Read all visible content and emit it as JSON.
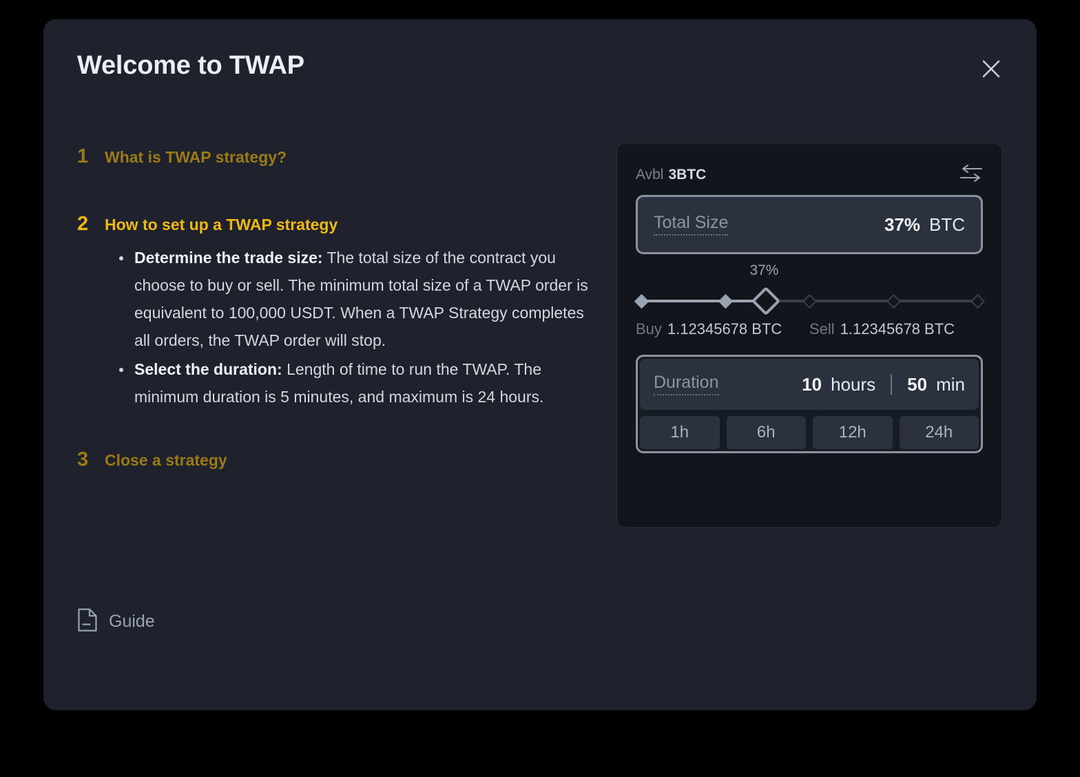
{
  "dialog": {
    "title": "Welcome to TWAP",
    "close_icon": "close-icon"
  },
  "steps": [
    {
      "number": "1",
      "title": "What is TWAP strategy?",
      "state": "inactive"
    },
    {
      "number": "2",
      "title": "How to set up a TWAP strategy",
      "state": "active"
    },
    {
      "number": "3",
      "title": "Close a strategy",
      "state": "inactive"
    }
  ],
  "bullets": [
    {
      "lead": "Determine the trade size:",
      "body": " The total size of the contract you choose to buy or sell. The minimum total size of a TWAP order is equivalent to 100,000 USDT. When a TWAP Strategy completes all orders, the TWAP order will stop."
    },
    {
      "lead": "Select the duration:",
      "body": " Length of time to run the TWAP. The minimum duration is 5 minutes, and maximum is 24 hours."
    }
  ],
  "guide": {
    "label": "Guide",
    "icon": "document-icon"
  },
  "panel": {
    "available": {
      "label": "Avbl",
      "value": "3BTC"
    },
    "swap_icon": "swap-arrows-icon",
    "total_size": {
      "label": "Total Size",
      "value": "37%",
      "unit": "BTC"
    },
    "slider": {
      "value_label": "37%",
      "percent": 37,
      "ticks": [
        0,
        25,
        50,
        75,
        100
      ]
    },
    "buy": {
      "label": "Buy",
      "value": "1.12345678 BTC"
    },
    "sell": {
      "label": "Sell",
      "value": "1.12345678 BTC"
    },
    "duration": {
      "label": "Duration",
      "hours_value": "10",
      "hours_unit": "hours",
      "minutes_value": "50",
      "minutes_unit": "min",
      "presets": [
        "1h",
        "6h",
        "12h",
        "24h"
      ]
    }
  },
  "colors": {
    "accent_active": "#f0b90b",
    "accent_inactive": "#9c7a14",
    "dialog_bg": "#1e222c",
    "panel_bg": "#12151c",
    "field_bg": "#2b323d",
    "field_border": "#8d949f"
  }
}
